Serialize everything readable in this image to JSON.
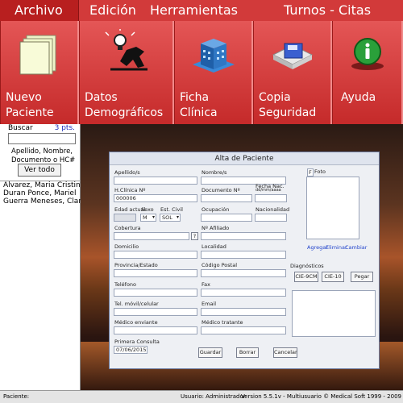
{
  "menu": {
    "items": [
      "Archivo",
      "Edición",
      "Herramientas",
      "Turnos - Citas"
    ]
  },
  "toolbar": {
    "buttons": [
      {
        "label_line1": "Nuevo",
        "label_line2": "Paciente",
        "icon": "documents-icon"
      },
      {
        "label_line1": "Datos",
        "label_line2": "Demográficos",
        "icon": "person-lightbulb-icon"
      },
      {
        "label_line1": "Ficha",
        "label_line2": "Clínica",
        "icon": "building-icon"
      },
      {
        "label_line1": "Copia",
        "label_line2": "Seguridad",
        "icon": "floppy-disk-icon"
      },
      {
        "label_line1": "Ayuda",
        "label_line2": "",
        "icon": "info-icon"
      }
    ]
  },
  "search": {
    "label": "Buscar",
    "points": "3 pts.",
    "hint_line1": "Apellido, Nombre,",
    "hint_line2": "Documento o HC#",
    "view_all": "Ver todo",
    "results": [
      "Alvarez, Maria Cristina",
      "Duran Ponce, Mariel",
      "Guerra Meneses, Clari"
    ]
  },
  "dialog": {
    "title": "Alta de Paciente",
    "labels": {
      "apellido": "Apellido/s",
      "nombre": "Nombre/s",
      "hclinica": "H.Clínica Nº",
      "documento": "Documento Nº",
      "fecha_nac": "Fecha Nac.",
      "fecha_nac_hint": "dd/mm/aaaa",
      "edad": "Edad actual",
      "sexo": "Sexo",
      "est_civil": "Est. Civil",
      "ocupacion": "Ocupación",
      "nacionalidad": "Nacionalidad",
      "cobertura": "Cobertura",
      "afiliado": "Nº Afiliado",
      "domicilio": "Domicilio",
      "localidad": "Localidad",
      "provincia": "Provincia/Estado",
      "codigo_postal": "Código Postal",
      "telefono": "Teléfono",
      "fax": "Fax",
      "tel_movil": "Tel. móvil/celular",
      "email": "Email",
      "medico_enviante": "Médico enviante",
      "medico_tratante": "Médico tratante",
      "primera_consulta": "Primera Consulta",
      "foto": "Foto",
      "foto_prefix": "F",
      "diagnosticos": "Diagnósticos"
    },
    "values": {
      "hclinica": "000006",
      "sexo": "M",
      "est_civil": "SOL",
      "primera_consulta": "07/06/2015",
      "cobertura_btn": "?"
    },
    "photo_links": [
      "Agregar",
      "Eliminar",
      "Cambiar"
    ],
    "diag_buttons": [
      "CIE-9CM",
      "CIE-10",
      "Pegar"
    ],
    "buttons": [
      "Guardar",
      "Borrar",
      "Cancelar"
    ]
  },
  "status": {
    "left": "Paciente:",
    "middle": "Usuario: Administrador",
    "right": "Version 5.5.1v - Multiusuario  © Medical Soft 1999 - 2009"
  }
}
